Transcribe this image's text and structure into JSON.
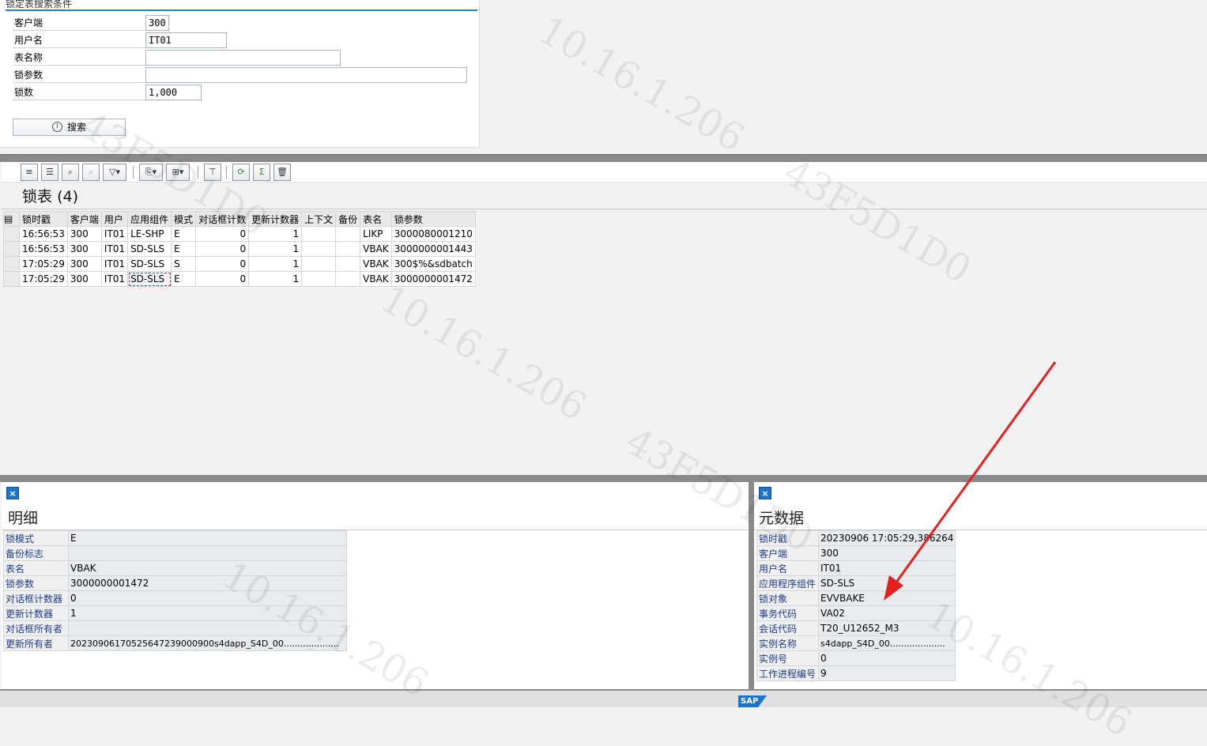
{
  "search": {
    "title": "锁定表搜索条件",
    "fields": [
      {
        "label": "客户端",
        "value": "300"
      },
      {
        "label": "用户名",
        "value": "IT01"
      },
      {
        "label": "表名称",
        "value": ""
      },
      {
        "label": "锁参数",
        "value": ""
      },
      {
        "label": "锁数",
        "value": "1,000"
      }
    ],
    "button_label": "搜索"
  },
  "toolbar": {
    "icons": [
      "align-center-icon",
      "filter-lines-icon",
      "find-icon",
      "find-next-icon",
      "filter-icon",
      "export-icon",
      "layout-icon",
      "detail-icon",
      "refresh-icon",
      "sum-icon",
      "delete-icon"
    ]
  },
  "lock_table": {
    "title": "锁表",
    "count": "(4)",
    "columns": [
      "锁时戳",
      "客户端",
      "用户",
      "应用组件",
      "模式",
      "对话框计数",
      "更新计数器",
      "上下文",
      "备份",
      "表名",
      "锁参数"
    ],
    "rows": [
      [
        "16:56:53",
        "300",
        "IT01",
        "LE-SHP",
        "E",
        "0",
        "1",
        "",
        "",
        "LIKP",
        "3000080001210"
      ],
      [
        "16:56:53",
        "300",
        "IT01",
        "SD-SLS",
        "E",
        "0",
        "1",
        "",
        "",
        "VBAK",
        "3000000001443"
      ],
      [
        "17:05:29",
        "300",
        "IT01",
        "SD-SLS",
        "S",
        "0",
        "1",
        "",
        "",
        "VBAK",
        "300$%&sdbatch"
      ],
      [
        "17:05:29",
        "300",
        "IT01",
        "SD-SLS",
        "E",
        "0",
        "1",
        "",
        "",
        "VBAK",
        "3000000001472"
      ]
    ]
  },
  "detail": {
    "title": "明细",
    "rows": [
      {
        "k": "锁模式",
        "v": "E"
      },
      {
        "k": "备份标志",
        "v": ""
      },
      {
        "k": "表名",
        "v": "VBAK"
      },
      {
        "k": "锁参数",
        "v": "3000000001472"
      },
      {
        "k": "对话框计数器",
        "v": "0"
      },
      {
        "k": "更新计数器",
        "v": "1"
      },
      {
        "k": "对话框所有者",
        "v": ""
      },
      {
        "k": "更新所有者",
        "v": "20230906170525647239000900s4dapp_S4D_00...................."
      }
    ]
  },
  "metadata": {
    "title": "元数据",
    "rows": [
      {
        "k": "锁时戳",
        "v": "20230906 17:05:29,386264"
      },
      {
        "k": "客户端",
        "v": "300"
      },
      {
        "k": "用户名",
        "v": "IT01"
      },
      {
        "k": "应用程序组件",
        "v": "SD-SLS"
      },
      {
        "k": "锁对象",
        "v": "EVVBAKE"
      },
      {
        "k": "事务代码",
        "v": "VA02"
      },
      {
        "k": "会话代码",
        "v": "T20_U12652_M3"
      },
      {
        "k": "实例名称",
        "v": "s4dapp_S4D_00...................."
      },
      {
        "k": "实例号",
        "v": "0"
      },
      {
        "k": "工作进程编号",
        "v": "9"
      }
    ]
  },
  "watermark": {
    "ip": "10.16.1.206",
    "code": "43F5D1D0"
  },
  "footer": {
    "logo": "SAP"
  },
  "colors": {
    "accent": "#1f74c7",
    "arrow": "#e32020"
  }
}
